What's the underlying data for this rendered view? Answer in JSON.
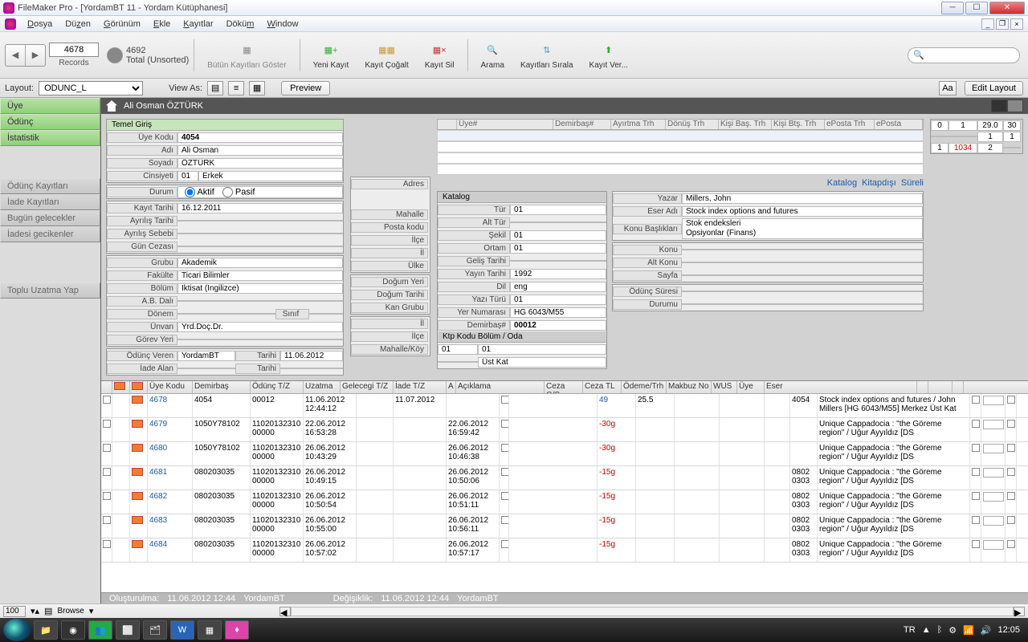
{
  "window": {
    "title": "FileMaker Pro - [YordamBT 11 - Yordam Kütüphanesi]"
  },
  "menu": [
    "Dosya",
    "Düzen",
    "Görünüm",
    "Ekle",
    "Kayıtlar",
    "Döküm",
    "Window"
  ],
  "toolbar": {
    "record_no": "4678",
    "total": "4692",
    "total_label": "Total (Unsorted)",
    "records_label": "Records",
    "show_all": "Bütün Kayıtları Göster",
    "new_rec": "Yeni Kayıt",
    "dup_rec": "Kayıt Çoğalt",
    "del_rec": "Kayıt Sil",
    "find": "Arama",
    "sort": "Kayıtları Sırala",
    "save": "Kayıt Ver..."
  },
  "layoutbar": {
    "layout": "Layout:",
    "layout_val": "ODUNC_L",
    "viewas": "View As:",
    "preview": "Preview",
    "edit": "Edit Layout"
  },
  "sidebar": {
    "uye": "Üye",
    "odunc": "Ödünç",
    "istatistik": "İstatistik",
    "odunc_kayit": "Ödünç Kayıtları",
    "iade_kayit": "İade Kayıtları",
    "bugun": "Bugün gelecekler",
    "geciken": "İadesi gecikenler",
    "toplu": "Toplu Uzatma Yap"
  },
  "header_name": "Ali Osman ÖZTÜRK",
  "temel": {
    "title": "Temel Giriş",
    "uye_kodu_l": "Üye Kodu",
    "uye_kodu": "4054",
    "adi_l": "Adı",
    "adi": "Ali Osman",
    "soyadi_l": "Soyadı",
    "soyadi": "ÖZTÜRK",
    "cinsiyet_l": "Cinsiyeti",
    "cins_code": "01",
    "cins_txt": "Erkek",
    "durum_l": "Durum",
    "aktif": "Aktif",
    "pasif": "Pasif",
    "kayit_l": "Kayıt Tarihi",
    "kayit": "16.12.2011",
    "ayrilis_l": "Ayrılış Tarihi",
    "ayrilis_seb_l": "Ayrılış Sebebi",
    "gun_ceza_l": "Gün Cezası",
    "grubu_l": "Grubu",
    "grubu": "Akademik",
    "fakulte_l": "Fakülte",
    "fakulte": "Ticari Bilimler",
    "bolum_l": "Bölüm",
    "bolum": "İktisat (İngilizce)",
    "abd_l": "A.B. Dalı",
    "donem_l": "Dönem",
    "sinif_l": "Sınıf",
    "unvan_l": "Ünvan",
    "unvan": "Yrd.Doç.Dr.",
    "gorev_l": "Görev Yeri",
    "odunc_veren_l": "Ödünç Veren",
    "odunc_veren": "YordamBT",
    "tarih_l": "Tarihi",
    "tarih1": "11.06.2012",
    "iade_alan_l": "İade Alan"
  },
  "adres": {
    "adres_l": "Adres",
    "mahalle_l": "Mahalle",
    "pk_l": "Posta kodu",
    "ilce_l": "İlçe",
    "il_l": "İl",
    "ulke_l": "Ülke",
    "dyeri_l": "Doğum Yeri",
    "dtarih_l": "Doğum Tarihi",
    "kan_l": "Kan Grubu",
    "mahkoy_l": "Mahalle/Köy"
  },
  "upper_headers": [
    "",
    "Üye#",
    "Demirbaş#",
    "Ayırtma Trh",
    "Dönüş Trh",
    "Kişi Baş. Trh",
    "Kişi Btş. Trh",
    "ePosta Trh",
    "ePosta"
  ],
  "links": {
    "katalog": "Katalog",
    "kitapdisi": "Kitapdışı",
    "sureli": "Süreli"
  },
  "katalog": {
    "title": "Katalog",
    "tur_l": "Tür",
    "tur": "01",
    "alttur_l": "Alt Tür",
    "sekil_l": "Şekil",
    "sekil": "01",
    "ortam_l": "Ortam",
    "ortam": "01",
    "gelis_l": "Geliş Tarihi",
    "yayin_l": "Yayın Tarihi",
    "yayin": "1992",
    "dil_l": "Dil",
    "dil": "eng",
    "yazt_l": "Yazı Türü",
    "yazt": "01",
    "yer_l": "Yer Numarası",
    "yer": "HG 6043/M55",
    "demirbas_l": "Demirbaş#",
    "demirbas": "00012",
    "ktp_title": "Ktp Kodu Bölüm / Oda",
    "ktp1": "01",
    "ktp2": "01",
    "ustkat": "Üst Kat",
    "yazar_l": "Yazar",
    "yazar": "Millers, John",
    "eser_l": "Eser Adı",
    "eser": "Stock index options and futures",
    "konu_b_l": "Konu Başlıkları",
    "konu_b": "Stok endeksleri\nOpsiyonlar (Finans)",
    "konu_l": "Konu",
    "altkonu_l": "Alt Konu",
    "sayfa_l": "Sayfa",
    "odunc_sure_l": "Ödünç Süresi",
    "durumu_l": "Durumu"
  },
  "mini": {
    "r1": [
      "0",
      "1",
      "29.0",
      "30"
    ],
    "r2": [
      "",
      "",
      "1",
      "1"
    ],
    "r3": [
      "1",
      "1034",
      "2",
      ""
    ]
  },
  "grid": {
    "headers": [
      "",
      "",
      "",
      "Üye Kodu",
      "Demirbaş",
      "Ödünç T/Z",
      "Uzatma",
      "Gelecegi T/Z",
      "İade T/Z",
      "A",
      "Açıklama",
      "Ceza G/S",
      "Ceza TL",
      "Ödeme/Trh",
      "Makbuz No",
      "WUS",
      "Üye",
      "Eser",
      "",
      "",
      ""
    ],
    "rows": [
      {
        "id": "4678",
        "i": true,
        "uye": "4054",
        "dem": "00012",
        "odunc": "11.06.2012\n12:44:12",
        "gelecek": "11.07.2012",
        "iade": "",
        "ceza": "49",
        "cezatl": "25.5",
        "uyen": "4054",
        "eser": "Stock index options and futures / John Millers  [HG 6043/M55] Merkez Üst Kat",
        "eser_code": "[HG 6043/M55]"
      },
      {
        "id": "4679",
        "i": true,
        "uye": "1050Y78102",
        "dem": "11020132310\n00000",
        "odunc": "22.06.2012\n16:53:28",
        "gelecek": "",
        "iade": "22.06.2012\n16:59:42",
        "ceza": "-30g",
        "uyen": "",
        "eser": "Unique Cappadocia : \"the Göreme region\" / Uğur Ayyıldız  [DS"
      },
      {
        "id": "4680",
        "i": true,
        "uye": "1050Y78102",
        "dem": "11020132310\n00000",
        "odunc": "26.06.2012\n10:43:29",
        "gelecek": "",
        "iade": "26.06.2012\n10:46:38",
        "ceza": "-30g",
        "uyen": "",
        "eser": "Unique Cappadocia : \"the Göreme region\" / Uğur Ayyıldız  [DS"
      },
      {
        "id": "4681",
        "i": true,
        "uye": "080203035",
        "dem": "11020132310\n00000",
        "odunc": "26.06.2012\n10:49:15",
        "gelecek": "",
        "iade": "26.06.2012\n10:50:06",
        "ceza": "-15g",
        "uyen": "0802\n0303",
        "eser": "Unique Cappadocia : \"the Göreme region\" / Uğur Ayyıldız  [DS"
      },
      {
        "id": "4682",
        "i": true,
        "uye": "080203035",
        "dem": "11020132310\n00000",
        "odunc": "26.06.2012\n10:50:54",
        "gelecek": "",
        "iade": "26.06.2012\n10:51:11",
        "ceza": "-15g",
        "uyen": "0802\n0303",
        "eser": "Unique Cappadocia : \"the Göreme region\" / Uğur Ayyıldız  [DS"
      },
      {
        "id": "4683",
        "i": true,
        "uye": "080203035",
        "dem": "11020132310\n00000",
        "odunc": "26.06.2012\n10:55:00",
        "gelecek": "",
        "iade": "26.06.2012\n10:56:11",
        "ceza": "-15g",
        "uyen": "0802\n0303",
        "eser": "Unique Cappadocia : \"the Göreme region\" / Uğur Ayyıldız  [DS"
      },
      {
        "id": "4684",
        "i": true,
        "uye": "080203035",
        "dem": "11020132310\n00000",
        "odunc": "26.06.2012\n10:57:02",
        "gelecek": "",
        "iade": "26.06.2012\n10:57:17",
        "ceza": "-15g",
        "uyen": "0802\n0303",
        "eser": "Unique Cappadocia : \"the Göreme region\" / Uğur Ayyıldız  [DS"
      }
    ]
  },
  "footer": {
    "olusturma": "Oluşturulma:",
    "ot": "11.06.2012  12:44",
    "ou": "YordamBT",
    "degisiklik": "Değişiklik:",
    "dt": "11.06.2012  12:44",
    "du": "YordamBT"
  },
  "status": {
    "zoom": "100",
    "browse": "Browse"
  },
  "tray": {
    "lang": "TR",
    "time": "12:05"
  }
}
